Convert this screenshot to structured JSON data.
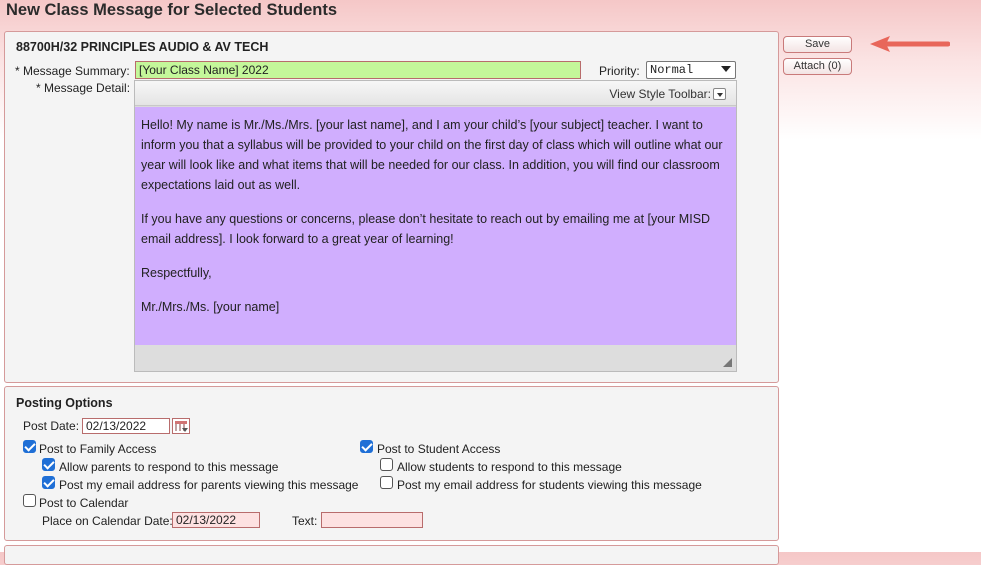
{
  "page_title": "New Class Message for Selected Students",
  "message_panel": {
    "course_title": "88700H/32 PRINCIPLES AUDIO & AV TECH",
    "summary_label": "* Message Summary:",
    "summary_value": "[Your Class Name] 2022",
    "priority_label": "Priority:",
    "priority_value": "Normal",
    "detail_label": "* Message Detail:",
    "style_toolbar_label": "View Style Toolbar:",
    "body": [
      "Hello! My name is Mr./Ms./Mrs. [your last name], and I am your child’s [your subject] teacher. I want to inform you that a syllabus will be provided to your child on the first day of class which will outline what our year will look like and what items that will be needed for our class. In addition, you will find our classroom expectations laid out as well.",
      " If you have any questions or concerns, please don’t hesitate to reach out by emailing me at [your MISD email address]. I look forward to a great year of learning!",
      "Respectfully,",
      "Mr./Mrs./Ms. [your name]"
    ]
  },
  "actions": {
    "save_label": "Save",
    "attach_label": "Attach (0)"
  },
  "posting_options": {
    "title": "Posting Options",
    "post_date_label": "Post Date:",
    "post_date_value": "02/13/2022",
    "family_access": {
      "label": "Post to Family Access",
      "checked": true
    },
    "allow_parents": {
      "label": "Allow parents to respond to this message",
      "checked": true
    },
    "parents_email": {
      "label": "Post my email address for parents viewing this message",
      "checked": true
    },
    "student_access": {
      "label": "Post to Student Access",
      "checked": true
    },
    "allow_students": {
      "label": "Allow students to respond to this message",
      "checked": false
    },
    "students_email": {
      "label": "Post my email address for students viewing this message",
      "checked": false
    },
    "post_to_calendar": {
      "label": "Post to Calendar",
      "checked": false
    },
    "calendar_date_label": "Place on Calendar Date:",
    "calendar_date_value": "02/13/2022",
    "text_label": "Text:",
    "text_value": ""
  },
  "colors": {
    "accent_arrow": "#e8665a",
    "summary_bg": "#c4f79a",
    "editor_bg": "#d0aefe",
    "checkbox_checked": "#1f6fd6"
  }
}
